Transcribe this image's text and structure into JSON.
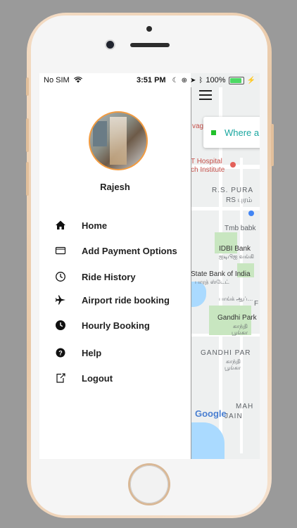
{
  "status_bar": {
    "carrier": "No SIM",
    "time": "3:51 PM",
    "battery": "100%",
    "battery_level": 1.0
  },
  "profile": {
    "name": "Rajesh"
  },
  "menu": [
    {
      "label": "Home",
      "icon": "home-icon"
    },
    {
      "label": "Add Payment Options",
      "icon": "card-icon"
    },
    {
      "label": "Ride History",
      "icon": "clock-icon"
    },
    {
      "label": "Airport ride booking",
      "icon": "airplane-icon"
    },
    {
      "label": "Hourly Booking",
      "icon": "clock-filled-icon"
    },
    {
      "label": "Help",
      "icon": "help-icon"
    },
    {
      "label": "Logout",
      "icon": "logout-icon"
    }
  ],
  "map": {
    "search_placeholder": "Where ar",
    "labels": {
      "vaga": "vaga",
      "hospital": "T Hospital",
      "institute": "ch Institute",
      "rs_puram": "R.S. PURA",
      "rs_puram_ta": "RS புரம்",
      "tmb": "Tmb babk",
      "idbi": "IDBI Bank",
      "idbi_ta": "ஐடிபிஐ வங்கி",
      "sbi": "State Bank of India",
      "sbi_ta": "பாரத் ஸ்டேட்",
      "bank_ta": "பாங்க் ஆப்…",
      "gandhi_park": "Gandhi Park",
      "gandhi_park_ta1": "காந்தி",
      "gandhi_park_ta2": "பூங்கா",
      "gandhi_para": "GANDHI PAR",
      "gandhi_para_ta1": "காந்தி",
      "gandhi_para_ta2": "பூங்கா",
      "google": "Google",
      "mah": "MAH",
      "jain": "JAIN",
      "f": "F"
    }
  },
  "colors": {
    "accent": "#f29b40",
    "map_search_text": "#1aa7a0",
    "status_green": "#22c12b"
  }
}
